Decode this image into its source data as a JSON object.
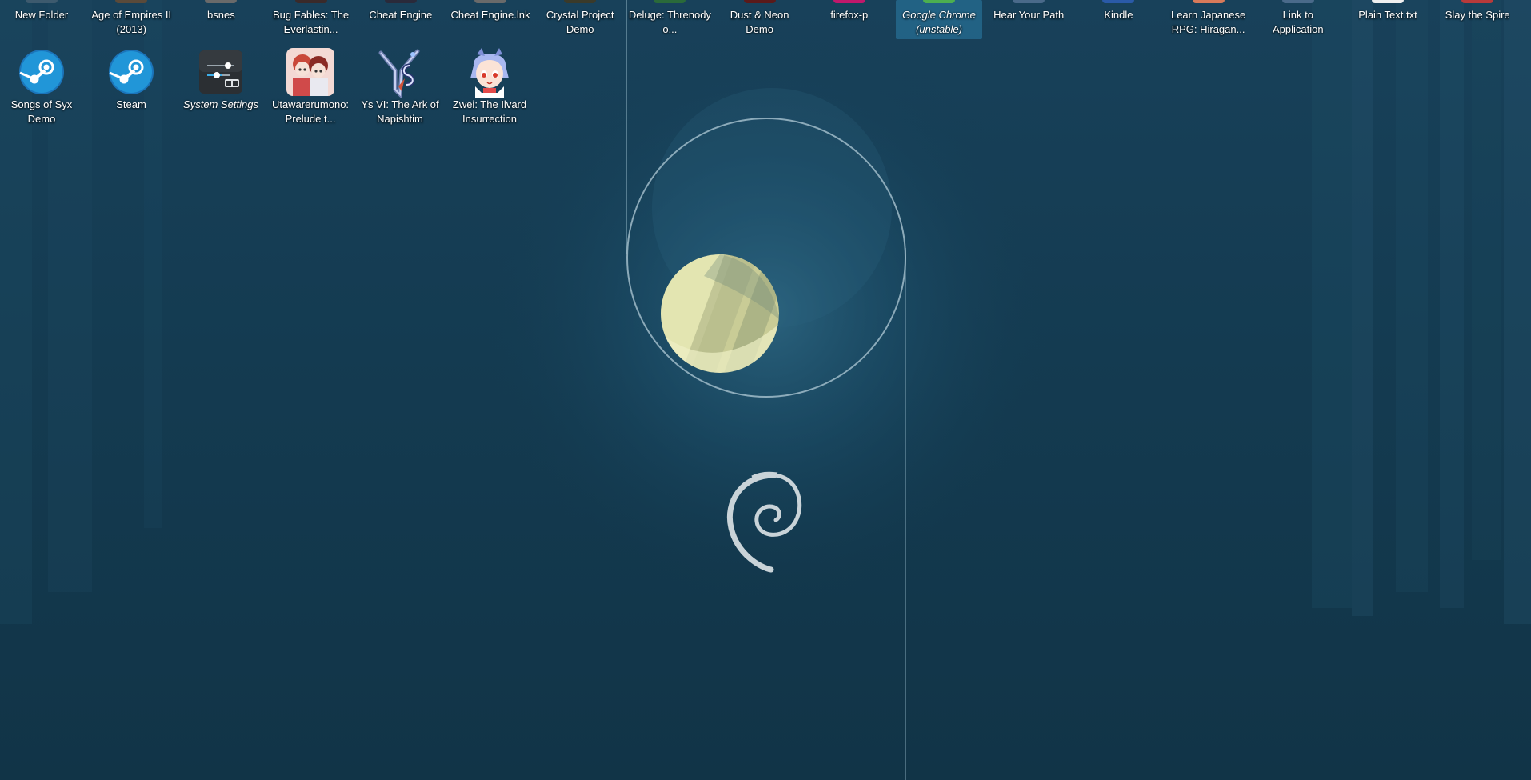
{
  "desktop": {
    "row1": [
      {
        "name": "new-folder",
        "label": "New Folder",
        "icon": "folder-icon",
        "color": "#3d5a6e"
      },
      {
        "name": "age-of-empires",
        "label": "Age of Empires II (2013)",
        "icon": "game-icon",
        "color": "#5a4a3a"
      },
      {
        "name": "bsnes",
        "label": "bsnes",
        "icon": "emulator-icon",
        "color": "#6a6a6a"
      },
      {
        "name": "bug-fables",
        "label": "Bug Fables: The Everlastin...",
        "icon": "game-icon",
        "color": "#3a2a2a"
      },
      {
        "name": "cheat-engine",
        "label": "Cheat Engine",
        "icon": "cheat-engine-icon",
        "color": "#2a2a3a"
      },
      {
        "name": "cheat-engine-lnk",
        "label": "Cheat Engine.lnk",
        "icon": "shortcut-icon",
        "color": "#6a6a6a"
      },
      {
        "name": "crystal-project",
        "label": "Crystal Project Demo",
        "icon": "game-icon",
        "color": "#3a3a2a"
      },
      {
        "name": "deluge",
        "label": "Deluge: Threnody o...",
        "icon": "game-icon",
        "color": "#2a6a3a"
      },
      {
        "name": "dust-neon",
        "label": "Dust & Neon Demo",
        "icon": "game-icon",
        "color": "#5a1a1a"
      },
      {
        "name": "firefox",
        "label": "firefox-p",
        "icon": "firefox-icon",
        "color": "#c2186b"
      },
      {
        "name": "google-chrome",
        "label": "Google Chrome (unstable)",
        "icon": "chrome-icon",
        "color": "#4caf50"
      },
      {
        "name": "hear-your-path",
        "label": "Hear Your Path",
        "icon": "app-icon",
        "color": "#4a6a8a"
      },
      {
        "name": "kindle",
        "label": "Kindle",
        "icon": "kindle-icon",
        "color": "#2a5aa8"
      },
      {
        "name": "learn-japanese",
        "label": "Learn Japanese RPG: Hiragan...",
        "icon": "game-icon",
        "color": "#d87a5a"
      },
      {
        "name": "link-to-application",
        "label": "Link to Application",
        "icon": "link-icon",
        "color": "#4a6a8a"
      },
      {
        "name": "plain-text",
        "label": "Plain Text.txt",
        "icon": "text-file-icon",
        "color": "#f0f0f0"
      },
      {
        "name": "slay-the-spire",
        "label": "Slay the Spire",
        "icon": "game-icon",
        "color": "#b83a3a"
      }
    ],
    "row2": [
      {
        "name": "songs-of-syx",
        "label": "Songs of Syx Demo",
        "icon": "steam-icon"
      },
      {
        "name": "steam",
        "label": "Steam",
        "icon": "steam-icon"
      },
      {
        "name": "system-settings",
        "label": "System Settings",
        "icon": "settings-icon"
      },
      {
        "name": "utawarerumono",
        "label": "Utawarerumono: Prelude t...",
        "icon": "anime-game-icon"
      },
      {
        "name": "ys-vi",
        "label": "Ys VI: The Ark of Napishtim",
        "icon": "ys-logo-icon"
      },
      {
        "name": "zwei",
        "label": "Zwei: The Ilvard Insurrection",
        "icon": "zwei-character-icon"
      }
    ]
  },
  "colors": {
    "accent": "#3daee9",
    "wallpaper": "#143b51",
    "steam_blue": "#1b75bb",
    "orb": "#e4e6b0"
  }
}
